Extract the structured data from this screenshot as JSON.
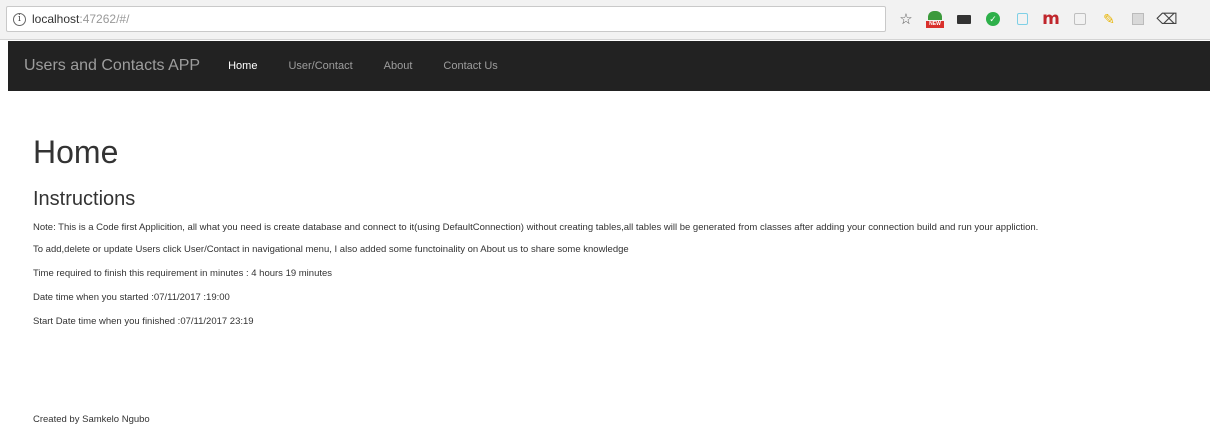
{
  "browser": {
    "url_host": "localhost",
    "url_rest": ":47262/#/"
  },
  "navbar": {
    "brand": "Users and Contacts APP",
    "items": [
      {
        "label": "Home",
        "active": true
      },
      {
        "label": "User/Contact",
        "active": false
      },
      {
        "label": "About",
        "active": false
      },
      {
        "label": "Contact Us",
        "active": false
      }
    ]
  },
  "main": {
    "title": "Home",
    "subtitle": "Instructions",
    "paragraphs": [
      "Note: This is a Code first Applicition, all what you need is create database and connect to it(using DefaultConnection) without creating tables,all tables will be generated from classes after adding your connection build and run your appliction.",
      "To add,delete or update Users click User/Contact in navigational menu, I also added some functoinality on About us to share some knowledge",
      "Time required to finish this requirement in minutes : 4 hours 19 minutes",
      "Date time when you started :07/11/2017 :19:00",
      "Start Date time when you finished :07/11/2017 23:19"
    ],
    "footer": "Created by Samkelo Ngubo"
  }
}
